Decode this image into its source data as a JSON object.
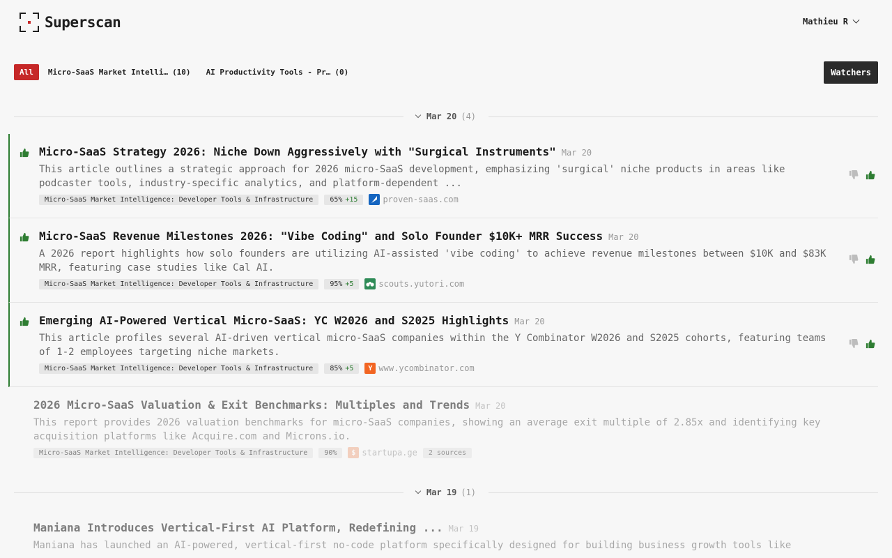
{
  "app": {
    "name": "Superscan"
  },
  "user": {
    "name": "Mathieu R"
  },
  "filters": {
    "all_label": "All",
    "items": [
      {
        "label": "Micro-SaaS Market Intelli…",
        "count": "(10)"
      },
      {
        "label": "AI Productivity Tools - Pr…",
        "count": "(0)"
      }
    ],
    "watchers_label": "Watchers"
  },
  "days": [
    {
      "label": "Mar 20",
      "count": "(4)"
    },
    {
      "label": "Mar 19",
      "count": "(1)"
    }
  ],
  "articles": [
    {
      "title": "Micro-SaaS Strategy 2026: Niche Down Aggressively with \"Surgical Instruments\"",
      "date": "Mar 20",
      "summary": "This article outlines a strategic approach for 2026 micro-SaaS development, emphasizing 'surgical' niche products in areas like podcaster tools, industry-specific analytics, and platform-dependent ...",
      "tag": "Micro-SaaS Market Intelligence: Developer Tools & Infrastructure",
      "score": "65%",
      "delta": "+15",
      "source": "proven-saas.com",
      "favicon_color": "#1565c0",
      "favicon_icon": "proven-saas-favicon-icon"
    },
    {
      "title": "Micro-SaaS Revenue Milestones 2026: \"Vibe Coding\" and Solo Founder $10K+ MRR Success",
      "date": "Mar 20",
      "summary": "A 2026 report highlights how solo founders are utilizing AI-assisted 'vibe coding' to achieve revenue milestones between $10K and $83K MRR, featuring case studies like Cal AI.",
      "tag": "Micro-SaaS Market Intelligence: Developer Tools & Infrastructure",
      "score": "95%",
      "delta": "+5",
      "source": "scouts.yutori.com",
      "favicon_color": "#2e8b57",
      "favicon_icon": "binoculars-favicon-icon"
    },
    {
      "title": "Emerging AI-Powered Vertical Micro-SaaS: YC W2026 and S2025 Highlights",
      "date": "Mar 20",
      "summary": "This article profiles several AI-driven vertical micro-SaaS companies within the Y Combinator W2026 and S2025 cohorts, featuring teams of 1-2 employees targeting niche markets.",
      "tag": "Micro-SaaS Market Intelligence: Developer Tools & Infrastructure",
      "score": "85%",
      "delta": "+5",
      "source": "www.ycombinator.com",
      "favicon_color": "#f26522",
      "favicon_letter": "Y"
    },
    {
      "title": "2026 Micro-SaaS Valuation & Exit Benchmarks: Multiples and Trends",
      "date": "Mar 20",
      "summary": "This report provides 2026 valuation benchmarks for micro-SaaS companies, showing an average exit multiple of 2.85x and identifying key acquisition platforms like Acquire.com and Microns.io.",
      "tag": "Micro-SaaS Market Intelligence: Developer Tools & Infrastructure",
      "score": "90%",
      "source": "startupa.ge",
      "favicon_color": "#e8743b",
      "favicon_letter": "$",
      "sources_count": "2 sources"
    },
    {
      "title": "Maniana Introduces Vertical-First AI Platform, Redefining ...",
      "date": "Mar 19",
      "summary": "Maniana has launched an AI-powered, vertical-first no-code platform specifically designed for building business growth tools like"
    }
  ],
  "colors": {
    "accent": "#c62828",
    "liked": "#2e7d32",
    "dark_button": "#2b2b2b"
  }
}
